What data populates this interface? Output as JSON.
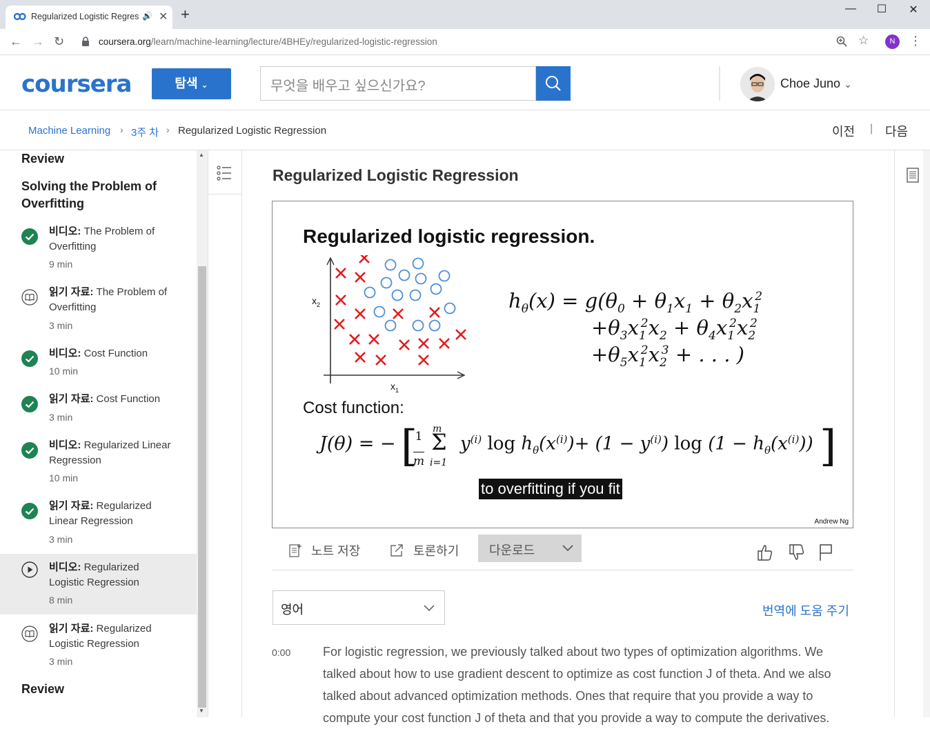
{
  "browser": {
    "tab_title": "Regularized Logistic Regres",
    "url_host": "coursera.org",
    "url_path": "/learn/machine-learning/lecture/4BHEy/regularized-logistic-regression",
    "profile_initial": "N"
  },
  "header": {
    "logo": "coursera",
    "explore_label": "탐색",
    "search_placeholder": "무엇을 배우고 싶으신가요?",
    "user_name": "Choe Juno"
  },
  "breadcrumb": {
    "items": [
      "Machine Learning",
      "3주 차",
      "Regularized Logistic Regression"
    ],
    "prev": "이전",
    "next": "다음"
  },
  "sidebar": {
    "sections": [
      "Review",
      "Solving the Problem of Overfitting",
      "Review"
    ],
    "items": [
      {
        "type": "비디오:",
        "title": "The Problem of Overfitting",
        "duration": "9 min",
        "status": "done"
      },
      {
        "type": "읽기 자료:",
        "title": "The Problem of Overfitting",
        "duration": "3 min",
        "status": "reading"
      },
      {
        "type": "비디오:",
        "title": "Cost Function",
        "duration": "10 min",
        "status": "done"
      },
      {
        "type": "읽기 자료:",
        "title": "Cost Function",
        "duration": "3 min",
        "status": "done"
      },
      {
        "type": "비디오:",
        "title": "Regularized Linear Regression",
        "duration": "10 min",
        "status": "done"
      },
      {
        "type": "읽기 자료:",
        "title": "Regularized Linear Regression",
        "duration": "3 min",
        "status": "done"
      },
      {
        "type": "비디오:",
        "title": "Regularized Logistic Regression",
        "duration": "8 min",
        "status": "playing"
      },
      {
        "type": "읽기 자료:",
        "title": "Regularized Logistic Regression",
        "duration": "3 min",
        "status": "reading"
      }
    ]
  },
  "lecture": {
    "title": "Regularized Logistic Regression",
    "slide_title": "Regularized logistic regression.",
    "axis_x": "x",
    "axis_x_sub": "1",
    "axis_y": "x",
    "axis_y_sub": "2",
    "cost_label": "Cost function:",
    "caption": "to overfitting if you fit",
    "credit": "Andrew Ng"
  },
  "toolbar": {
    "save_note": "노트 저장",
    "discuss": "토론하기",
    "download": "다운로드"
  },
  "transcript": {
    "language": "영어",
    "help_translate": "번역에 도움 주기",
    "timestamp": "0:00",
    "text": "For logistic regression, we previously talked about two types of optimization algorithms. We talked about how to use gradient descent to optimize as cost function J of theta. And we also talked about advanced optimization methods. Ones that require that you provide a way to compute your cost function J of theta and that you provide a way to compute the derivatives."
  },
  "colors": {
    "brand": "#2a73cc",
    "check": "#1f8354"
  }
}
